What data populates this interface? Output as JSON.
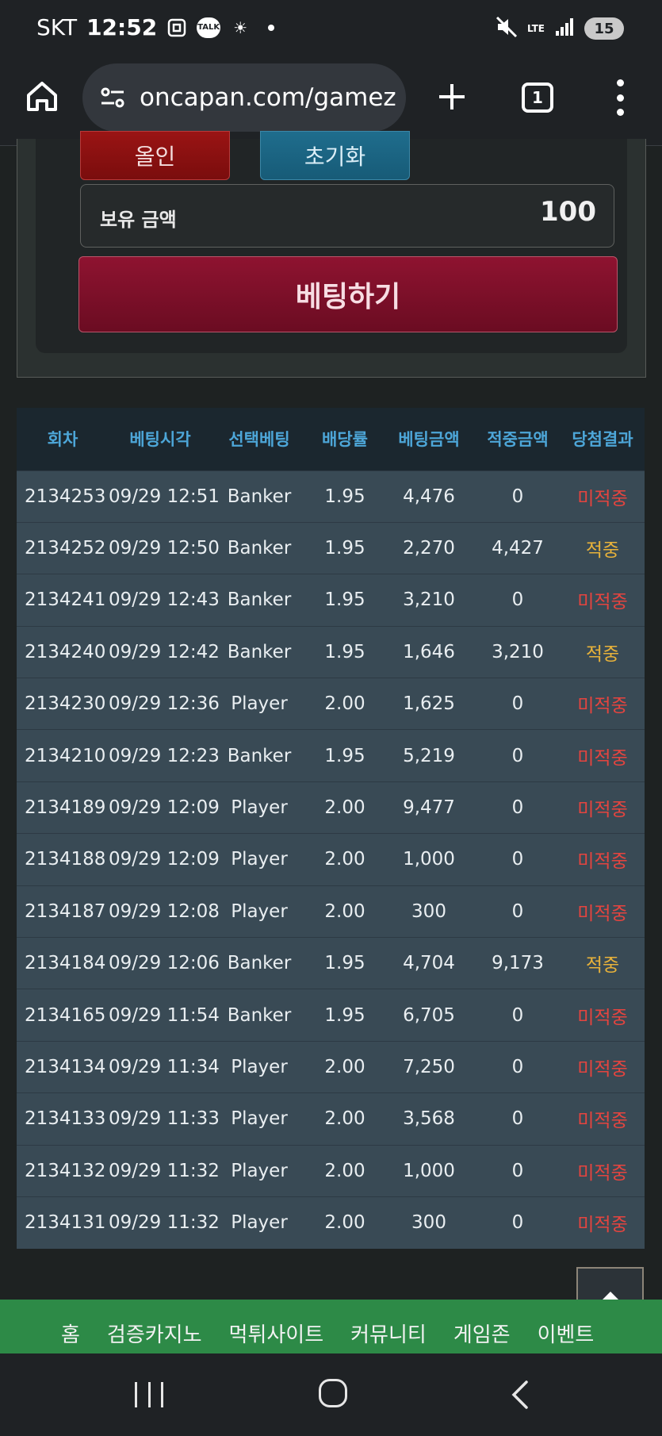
{
  "status_bar": {
    "carrier": "SKT",
    "time": "12:52",
    "talk_badge": "TALK",
    "network": "LTE",
    "battery": "15"
  },
  "browser": {
    "url": "oncapan.com/gamez",
    "tab_count": "1"
  },
  "bet_panel": {
    "allin_label": "올인",
    "reset_label": "초기화",
    "balance_label": "보유 금액",
    "balance_value": "100",
    "bet_button_label": "베팅하기"
  },
  "table": {
    "headers": [
      "회차",
      "베팅시각",
      "선택베팅",
      "배당률",
      "베팅금액",
      "적중금액",
      "당첨결과"
    ],
    "rows": [
      {
        "round": "2134253",
        "time": "09/29 12:51",
        "pick": "Banker",
        "odds": "1.95",
        "bet": "4,476",
        "won": "0",
        "result": "미적중",
        "status": "lose"
      },
      {
        "round": "2134252",
        "time": "09/29 12:50",
        "pick": "Banker",
        "odds": "1.95",
        "bet": "2,270",
        "won": "4,427",
        "result": "적중",
        "status": "win"
      },
      {
        "round": "2134241",
        "time": "09/29 12:43",
        "pick": "Banker",
        "odds": "1.95",
        "bet": "3,210",
        "won": "0",
        "result": "미적중",
        "status": "lose"
      },
      {
        "round": "2134240",
        "time": "09/29 12:42",
        "pick": "Banker",
        "odds": "1.95",
        "bet": "1,646",
        "won": "3,210",
        "result": "적중",
        "status": "win"
      },
      {
        "round": "2134230",
        "time": "09/29 12:36",
        "pick": "Player",
        "odds": "2.00",
        "bet": "1,625",
        "won": "0",
        "result": "미적중",
        "status": "lose"
      },
      {
        "round": "2134210",
        "time": "09/29 12:23",
        "pick": "Banker",
        "odds": "1.95",
        "bet": "5,219",
        "won": "0",
        "result": "미적중",
        "status": "lose"
      },
      {
        "round": "2134189",
        "time": "09/29 12:09",
        "pick": "Player",
        "odds": "2.00",
        "bet": "9,477",
        "won": "0",
        "result": "미적중",
        "status": "lose"
      },
      {
        "round": "2134188",
        "time": "09/29 12:09",
        "pick": "Player",
        "odds": "2.00",
        "bet": "1,000",
        "won": "0",
        "result": "미적중",
        "status": "lose"
      },
      {
        "round": "2134187",
        "time": "09/29 12:08",
        "pick": "Player",
        "odds": "2.00",
        "bet": "300",
        "won": "0",
        "result": "미적중",
        "status": "lose"
      },
      {
        "round": "2134184",
        "time": "09/29 12:06",
        "pick": "Banker",
        "odds": "1.95",
        "bet": "4,704",
        "won": "9,173",
        "result": "적중",
        "status": "win"
      },
      {
        "round": "2134165",
        "time": "09/29 11:54",
        "pick": "Banker",
        "odds": "1.95",
        "bet": "6,705",
        "won": "0",
        "result": "미적중",
        "status": "lose"
      },
      {
        "round": "2134134",
        "time": "09/29 11:34",
        "pick": "Player",
        "odds": "2.00",
        "bet": "7,250",
        "won": "0",
        "result": "미적중",
        "status": "lose"
      },
      {
        "round": "2134133",
        "time": "09/29 11:33",
        "pick": "Player",
        "odds": "2.00",
        "bet": "3,568",
        "won": "0",
        "result": "미적중",
        "status": "lose"
      },
      {
        "round": "2134132",
        "time": "09/29 11:32",
        "pick": "Player",
        "odds": "2.00",
        "bet": "1,000",
        "won": "0",
        "result": "미적중",
        "status": "lose"
      },
      {
        "round": "2134131",
        "time": "09/29 11:32",
        "pick": "Player",
        "odds": "2.00",
        "bet": "300",
        "won": "0",
        "result": "미적중",
        "status": "lose"
      }
    ]
  },
  "bottom_nav": {
    "items": [
      "홈",
      "검증카지노",
      "먹튀사이트",
      "커뮤니티",
      "게임존",
      "이벤트"
    ]
  },
  "colors": {
    "win": "#e8b23a",
    "lose": "#e5443f",
    "header_text": "#4da6d8",
    "nav_green": "#2d8a47",
    "bet_button": "#8e1330"
  }
}
